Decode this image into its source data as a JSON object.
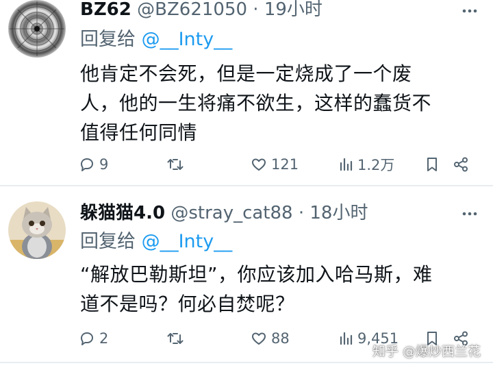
{
  "tweets": [
    {
      "name": "BZ62",
      "handle": "@BZ621050",
      "dot": "·",
      "time": "19小时",
      "reply_label": "回复给",
      "reply_to": "@__Inty__",
      "lines": [
        "他肯定不会死，但是一定烧成了一个废",
        "人，他的一生将痛不欲生，这样的蠢货不",
        "值得任何同情"
      ],
      "replies": "9",
      "retweets": "",
      "likes": "121",
      "views": "1.2万"
    },
    {
      "name": "躲猫猫4.0",
      "handle": "@stray_cat88",
      "dot": "·",
      "time": "18小时",
      "reply_label": "回复给",
      "reply_to": "@__Inty__",
      "lines": [
        "“解放巴勒斯坦”，你应该加入哈马斯，难",
        "道不是吗？何必自焚呢？"
      ],
      "replies": "2",
      "retweets": "",
      "likes": "88",
      "views": "9,451"
    }
  ],
  "watermark": "知乎 @爆炒西兰花",
  "colors": {
    "link": "#1d9bf0",
    "muted": "#536471",
    "text": "#0f1419",
    "separator": "#e6ecf0"
  },
  "icons": [
    "more-icon",
    "reply-icon",
    "retweet-icon",
    "like-icon",
    "views-icon",
    "bookmark-icon",
    "share-icon"
  ]
}
